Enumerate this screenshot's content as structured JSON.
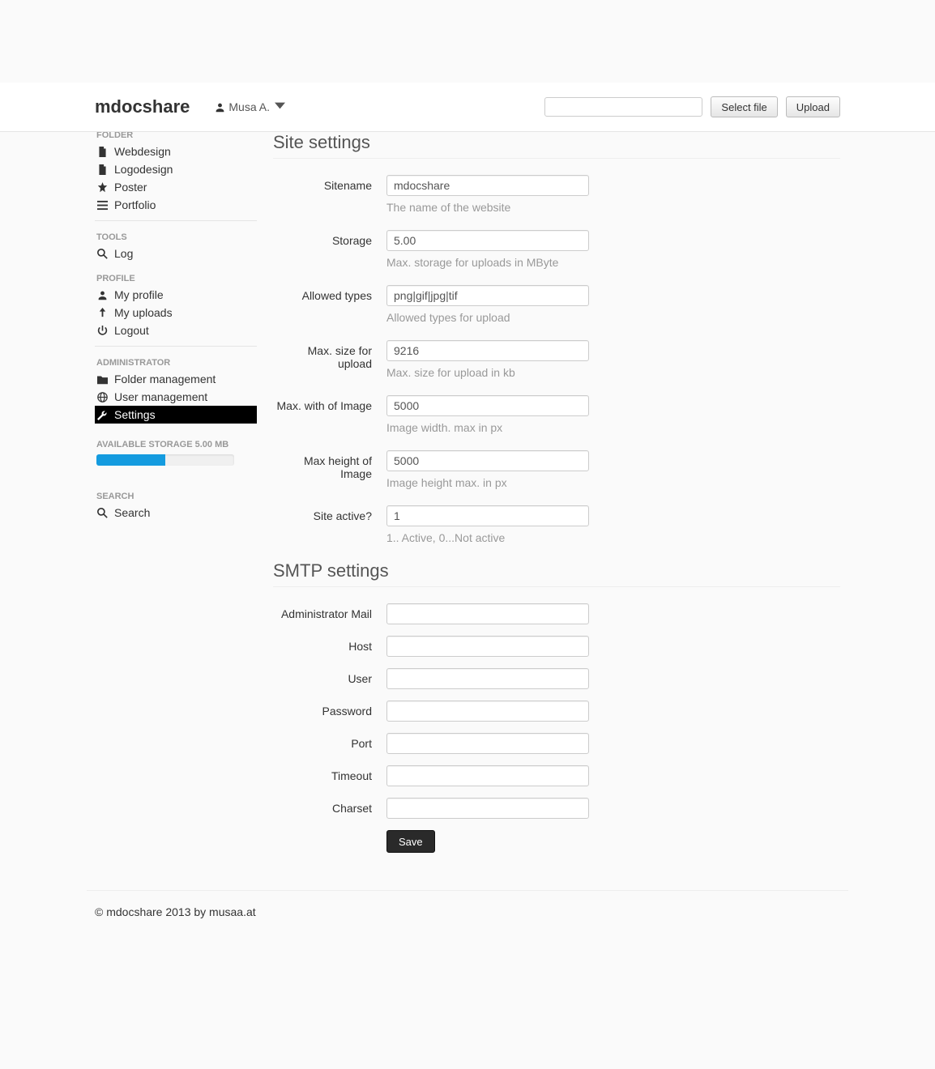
{
  "brand": "mdocshare",
  "user": {
    "name": "Musa A."
  },
  "topbar": {
    "select_file": "Select file",
    "upload": "Upload"
  },
  "sidebar": {
    "folder_header": "FOLDER",
    "folders": [
      {
        "label": "Webdesign"
      },
      {
        "label": "Logodesign"
      },
      {
        "label": "Poster"
      },
      {
        "label": "Portfolio"
      }
    ],
    "tools_header": "TOOLS",
    "tools": [
      {
        "label": "Log"
      }
    ],
    "profile_header": "PROFILE",
    "profile": [
      {
        "label": "My profile"
      },
      {
        "label": "My uploads"
      },
      {
        "label": "Logout"
      }
    ],
    "admin_header": "ADMINISTRATOR",
    "admin": [
      {
        "label": "Folder management"
      },
      {
        "label": "User management"
      },
      {
        "label": "Settings"
      }
    ],
    "storage_label": "AVAILABLE STORAGE 5.00 MB",
    "storage_percent": 50,
    "search_header": "SEARCH",
    "search_label": "Search"
  },
  "site_settings": {
    "header": "Site settings",
    "fields": {
      "sitename": {
        "label": "Sitename",
        "value": "mdocshare",
        "help": "The name of the website"
      },
      "storage": {
        "label": "Storage",
        "value": "5.00",
        "help": "Max. storage for uploads in MByte"
      },
      "allowed_types": {
        "label": "Allowed types",
        "value": "png|gif|jpg|tif",
        "help": "Allowed types for upload"
      },
      "max_size": {
        "label": "Max. size for upload",
        "value": "9216",
        "help": "Max. size for upload in kb"
      },
      "max_width": {
        "label": "Max. with of Image",
        "value": "5000",
        "help": "Image width. max in px"
      },
      "max_height": {
        "label": "Max height of Image",
        "value": "5000",
        "help": "Image height max. in px"
      },
      "active": {
        "label": "Site active?",
        "value": "1",
        "help": "1.. Active, 0...Not active"
      }
    }
  },
  "smtp_settings": {
    "header": "SMTP settings",
    "fields": {
      "admin_mail": {
        "label": "Administrator Mail",
        "value": ""
      },
      "host": {
        "label": "Host",
        "value": ""
      },
      "user": {
        "label": "User",
        "value": ""
      },
      "password": {
        "label": "Password",
        "value": ""
      },
      "port": {
        "label": "Port",
        "value": ""
      },
      "timeout": {
        "label": "Timeout",
        "value": ""
      },
      "charset": {
        "label": "Charset",
        "value": ""
      }
    },
    "save": "Save"
  },
  "footer": "© mdocshare 2013 by musaa.at"
}
